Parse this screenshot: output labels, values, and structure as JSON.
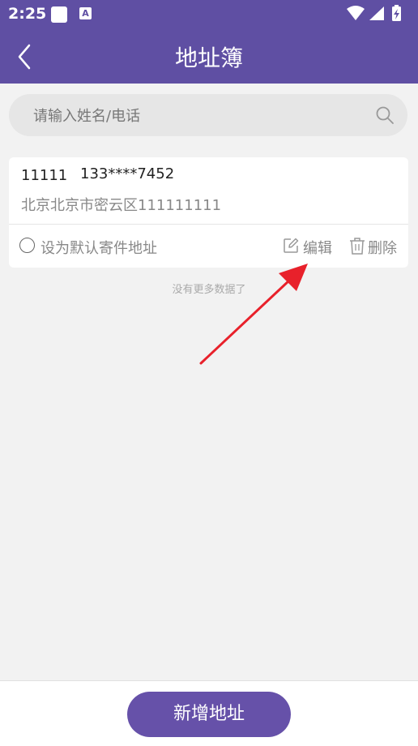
{
  "status_bar": {
    "time": "2:25",
    "a_icon_letter": "A"
  },
  "header": {
    "title": "地址簿",
    "background": "#5f4fa3"
  },
  "search": {
    "placeholder": "请输入姓名/电话",
    "value": ""
  },
  "addresses": [
    {
      "name": "11111",
      "phone": "133****7452",
      "address": "北京北京市密云区111111111",
      "default_label": "设为默认寄件地址",
      "is_default": false,
      "edit_label": "编辑",
      "delete_label": "删除"
    }
  ],
  "list_footer": "没有更多数据了",
  "bottom": {
    "add_label": "新增地址",
    "button_color": "#6651a9"
  },
  "annotation": {
    "arrow_color": "#e8212b",
    "points_to": "edit-button"
  }
}
